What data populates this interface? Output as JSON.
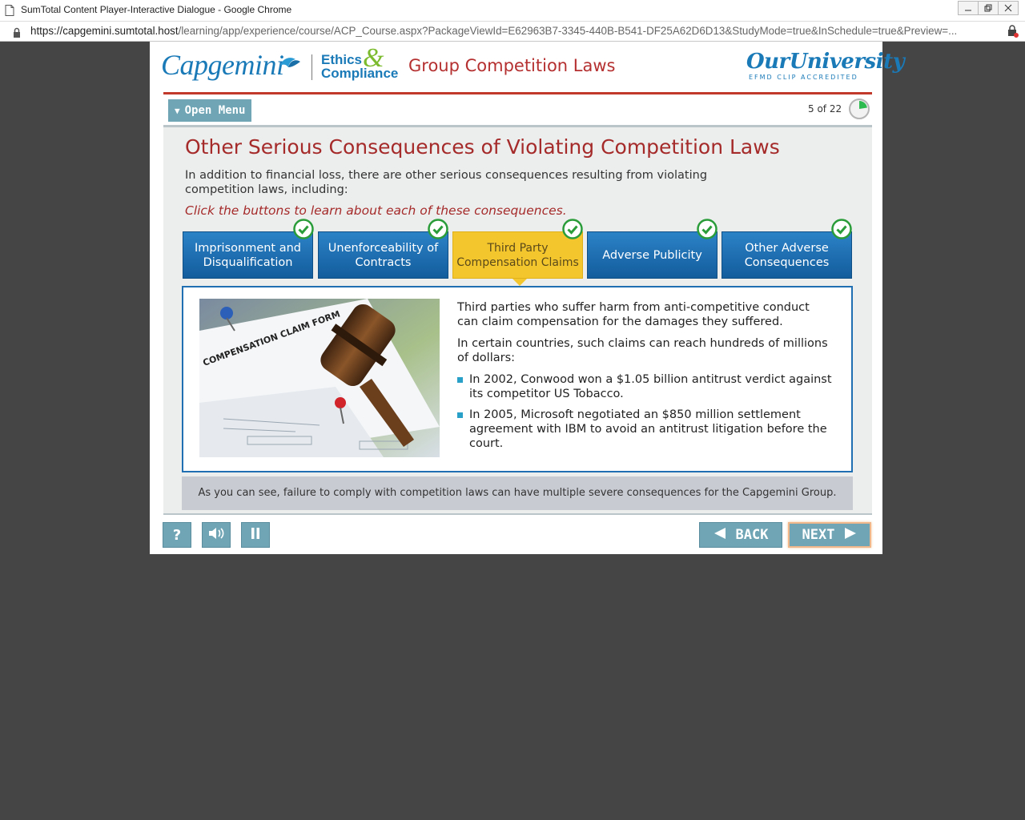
{
  "browser": {
    "window_title": "SumTotal Content Player-Interactive Dialogue - Google Chrome",
    "url_host": "https://capgemini.sumtotal.host",
    "url_path": "/learning/app/experience/course/ACP_Course.aspx?PackageViewId=E62963B7-3345-440B-B541-DF25A62D6D13&StudyMode=true&InSchedule=true&Preview=..."
  },
  "header": {
    "brand": "Capgemini",
    "ethics_line1": "Ethics",
    "ethics_amp": "&",
    "ethics_line2": "Compliance",
    "course_title": "Group Competition Laws",
    "university_logo": "OurUniversity",
    "university_sub": "EFMD CLIP ACCREDITED"
  },
  "menu": {
    "open_menu_label": "Open Menu",
    "page_indicator": "5 of 22",
    "progress_fraction": 0.227
  },
  "slide": {
    "title": "Other Serious Consequences of Violating Competition Laws",
    "intro": "In addition to financial loss, there are other serious consequences resulting from violating competition laws, including:",
    "instruction": "Click the buttons to learn about each of these consequences.",
    "tabs": [
      {
        "label": "Imprisonment and Disqualification",
        "visited": true,
        "active": false
      },
      {
        "label": "Unenforceability of Contracts",
        "visited": true,
        "active": false
      },
      {
        "label": "Third Party Compensation Claims",
        "visited": true,
        "active": true
      },
      {
        "label": "Adverse Publicity",
        "visited": true,
        "active": false
      },
      {
        "label": "Other Adverse Consequences",
        "visited": true,
        "active": false
      }
    ],
    "panel": {
      "image_caption": "COMPENSATION CLAIM FORM",
      "paragraph1": "Third parties who suffer harm from anti-competitive conduct can claim compensation for the damages they suffered.",
      "paragraph2": "In certain countries, such claims can reach hundreds of millions of dollars:",
      "bullets": [
        "In 2002, Conwood won a $1.05 billion antitrust verdict against its competitor US Tobacco.",
        "In 2005, Microsoft negotiated an $850 million settlement agreement with IBM to avoid an antitrust litigation before the court."
      ]
    },
    "summary": "As you can see, failure to comply with competition laws can have multiple severe consequences for the Capgemini Group."
  },
  "controls": {
    "help_label": "?",
    "back_label": "BACK",
    "next_label": "NEXT"
  },
  "colors": {
    "accent_red": "#a52a2a",
    "tab_blue": "#1f6fb2",
    "tab_active": "#f4c62d",
    "control_teal": "#6fa5b5",
    "check_green": "#2a9d3a"
  }
}
